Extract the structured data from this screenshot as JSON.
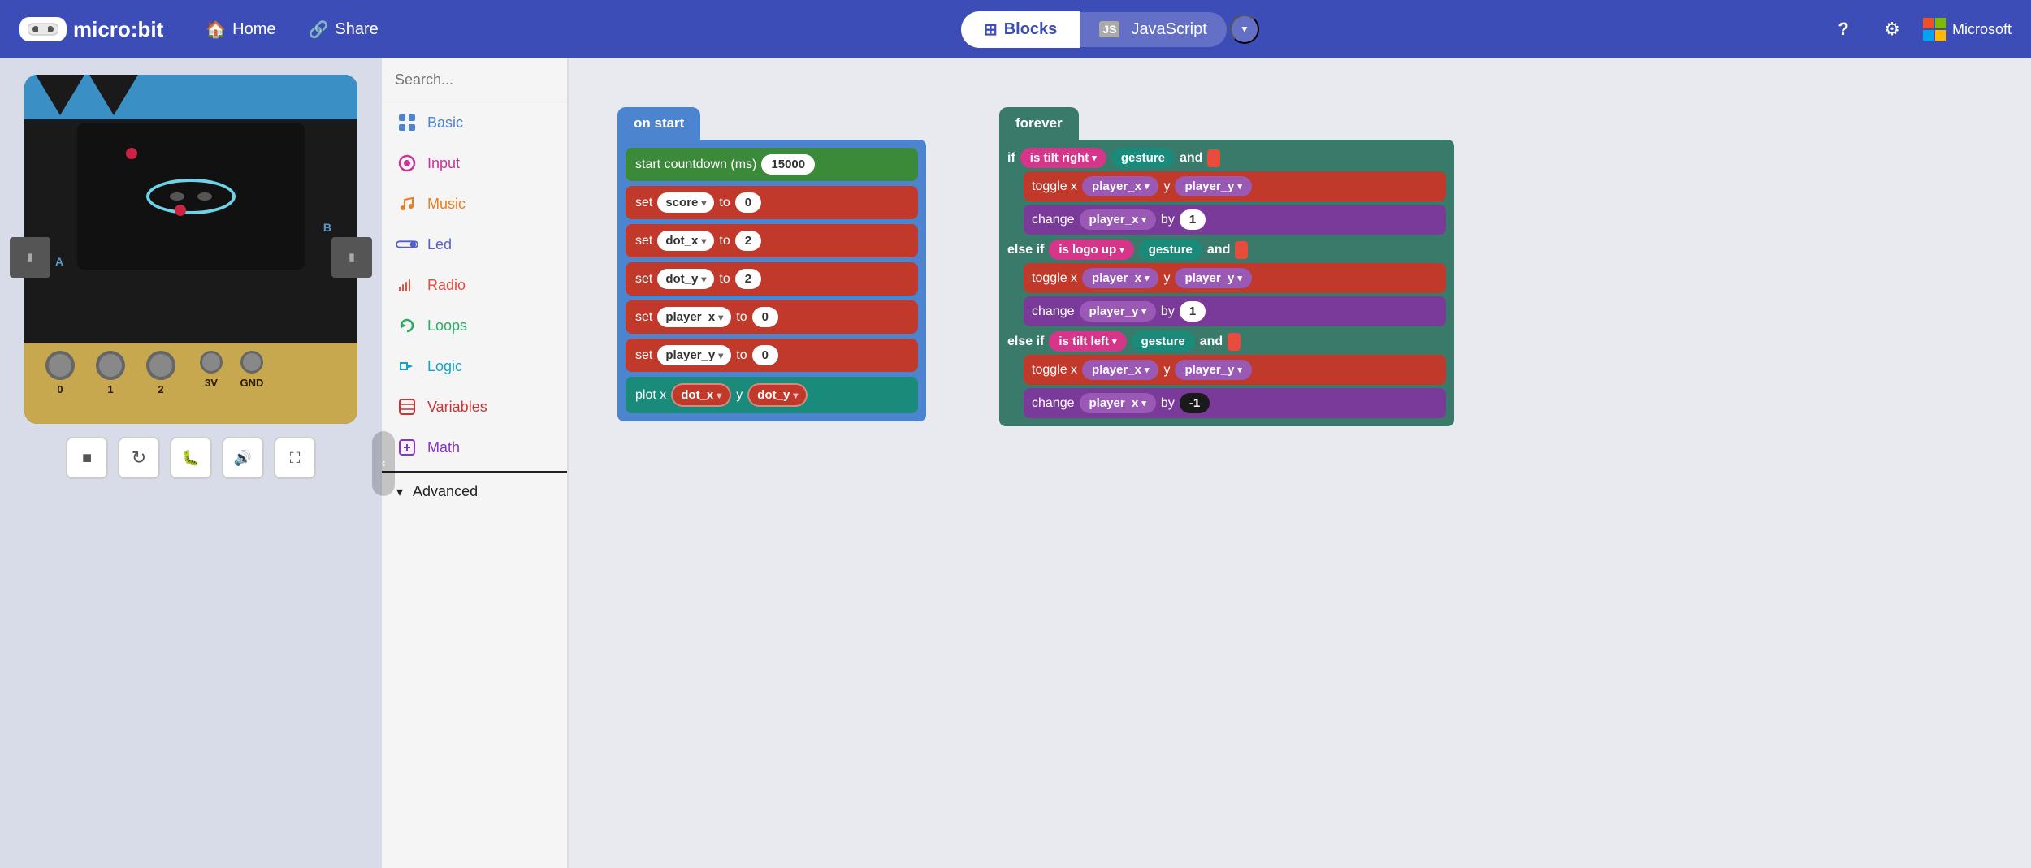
{
  "app": {
    "logo_text": "micro:bit",
    "nav_home": "Home",
    "nav_share": "Share",
    "tab_blocks": "Blocks",
    "tab_js": "JavaScript",
    "nav_help": "?",
    "nav_settings": "⚙",
    "ms_label": "Microsoft"
  },
  "simulator": {
    "ctrl_stop": "■",
    "ctrl_restart": "↻",
    "ctrl_debug": "🐛",
    "ctrl_sound": "🔊",
    "ctrl_fullscreen": "⛶",
    "pin_labels": [
      "0",
      "1",
      "2",
      "3V",
      "GND"
    ],
    "btn_a": "A",
    "btn_b": "B"
  },
  "categories": [
    {
      "name": "Basic",
      "color": "#4d84d0",
      "icon": "grid"
    },
    {
      "name": "Input",
      "color": "#cc3399",
      "icon": "target"
    },
    {
      "name": "Music",
      "color": "#e67e22",
      "icon": "music"
    },
    {
      "name": "Led",
      "color": "#555ecc",
      "icon": "toggle"
    },
    {
      "name": "Radio",
      "color": "#e74c3c",
      "icon": "signal"
    },
    {
      "name": "Loops",
      "color": "#27ae60",
      "icon": "loop"
    },
    {
      "name": "Logic",
      "color": "#17a2c8",
      "icon": "logic"
    },
    {
      "name": "Variables",
      "color": "#cc3333",
      "icon": "vars"
    },
    {
      "name": "Math",
      "color": "#8833cc",
      "icon": "math"
    }
  ],
  "advanced_label": "Advanced",
  "search_placeholder": "Search...",
  "on_start_label": "on start",
  "forever_label": "forever",
  "blocks": {
    "on_start": [
      {
        "type": "green",
        "label": "start countdown (ms)",
        "value": "15000"
      },
      {
        "type": "red",
        "set": "score",
        "to": "0"
      },
      {
        "type": "red",
        "set": "dot_x",
        "to": "2"
      },
      {
        "type": "red",
        "set": "dot_y",
        "to": "2"
      },
      {
        "type": "red",
        "set": "player_x",
        "to": "0"
      },
      {
        "type": "red",
        "set": "player_y",
        "to": "0"
      },
      {
        "type": "teal",
        "plot_x": "dot_x",
        "plot_y": "dot_y"
      }
    ],
    "forever": {
      "if1": {
        "condition_var": "is",
        "condition_val": "tilt right",
        "condition_label": "gesture",
        "connector": "and",
        "toggle_x": "player_x",
        "toggle_y": "player_y",
        "change_var": "player_x",
        "change_by": "1"
      },
      "elseif1": {
        "condition_var": "is",
        "condition_val": "logo up",
        "condition_label": "gesture",
        "connector": "and",
        "toggle_x": "player_x",
        "toggle_y": "player_y",
        "change_var": "player_y",
        "change_by": "1"
      },
      "elseif2": {
        "condition_var": "is",
        "condition_val": "tilt left",
        "condition_label": "gesture",
        "connector": "and",
        "toggle_x": "player_x",
        "toggle_y": "player_y",
        "change_var": "player_x",
        "change_by": "-1"
      }
    }
  }
}
